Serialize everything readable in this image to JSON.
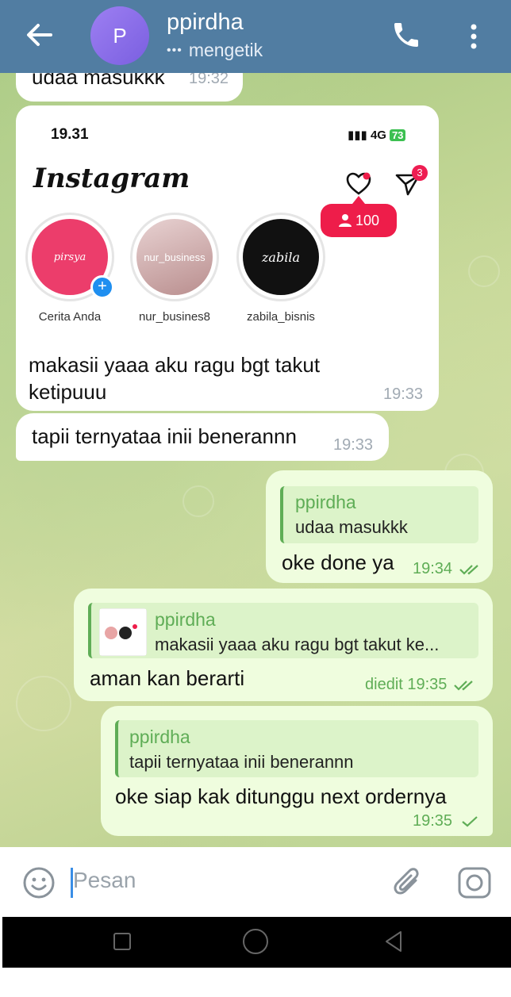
{
  "header": {
    "avatar_letter": "P",
    "name": "ppirdha",
    "status": "mengetik",
    "status_dots": "•••"
  },
  "messages": [
    {
      "id": "m1",
      "text": "udaa masukkk",
      "time": "19:32"
    },
    {
      "id": "m2",
      "screenshot": {
        "time": "19.31",
        "network": "4G",
        "battery": "73",
        "app_name": "Instagram",
        "dm_badge": "3",
        "followers_pill": "100",
        "stories": [
          {
            "caption": "Cerita Anda",
            "label": "pirsya"
          },
          {
            "caption": "nur_busines8",
            "label": "nur_business"
          },
          {
            "caption": "zabila_bisnis",
            "label": "zabila"
          }
        ]
      },
      "text": "makasii yaaa aku ragu bgt takut ketipuuu",
      "time": "19:33"
    },
    {
      "id": "m3",
      "text": "tapii ternyataa inii benerannn",
      "time": "19:33"
    },
    {
      "id": "m4",
      "reply_name": "ppirdha",
      "reply_text": "udaa masukkk",
      "text": "oke done ya",
      "time": "19:34"
    },
    {
      "id": "m5",
      "reply_name": "ppirdha",
      "reply_text": "makasii yaaa aku ragu bgt takut ke...",
      "text": "aman kan berarti",
      "edited": "diedit",
      "time": "19:35"
    },
    {
      "id": "m6",
      "reply_name": "ppirdha",
      "reply_text": "tapii ternyataa inii benerannn",
      "text": "oke siap kak ditunggu next ordernya",
      "time": "19:35"
    }
  ],
  "input": {
    "placeholder": "Pesan"
  },
  "colors": {
    "header": "#517da2",
    "outgoing_bubble": "#effdde",
    "accent_green": "#5fad56",
    "instagram_red": "#ee1d4a"
  },
  "icons": [
    "back-arrow-icon",
    "phone-icon",
    "more-vert-icon",
    "emoji-icon",
    "attach-icon",
    "camera-icon",
    "heart-icon",
    "send-icon",
    "person-icon",
    "double-check-icon",
    "single-check-icon"
  ]
}
